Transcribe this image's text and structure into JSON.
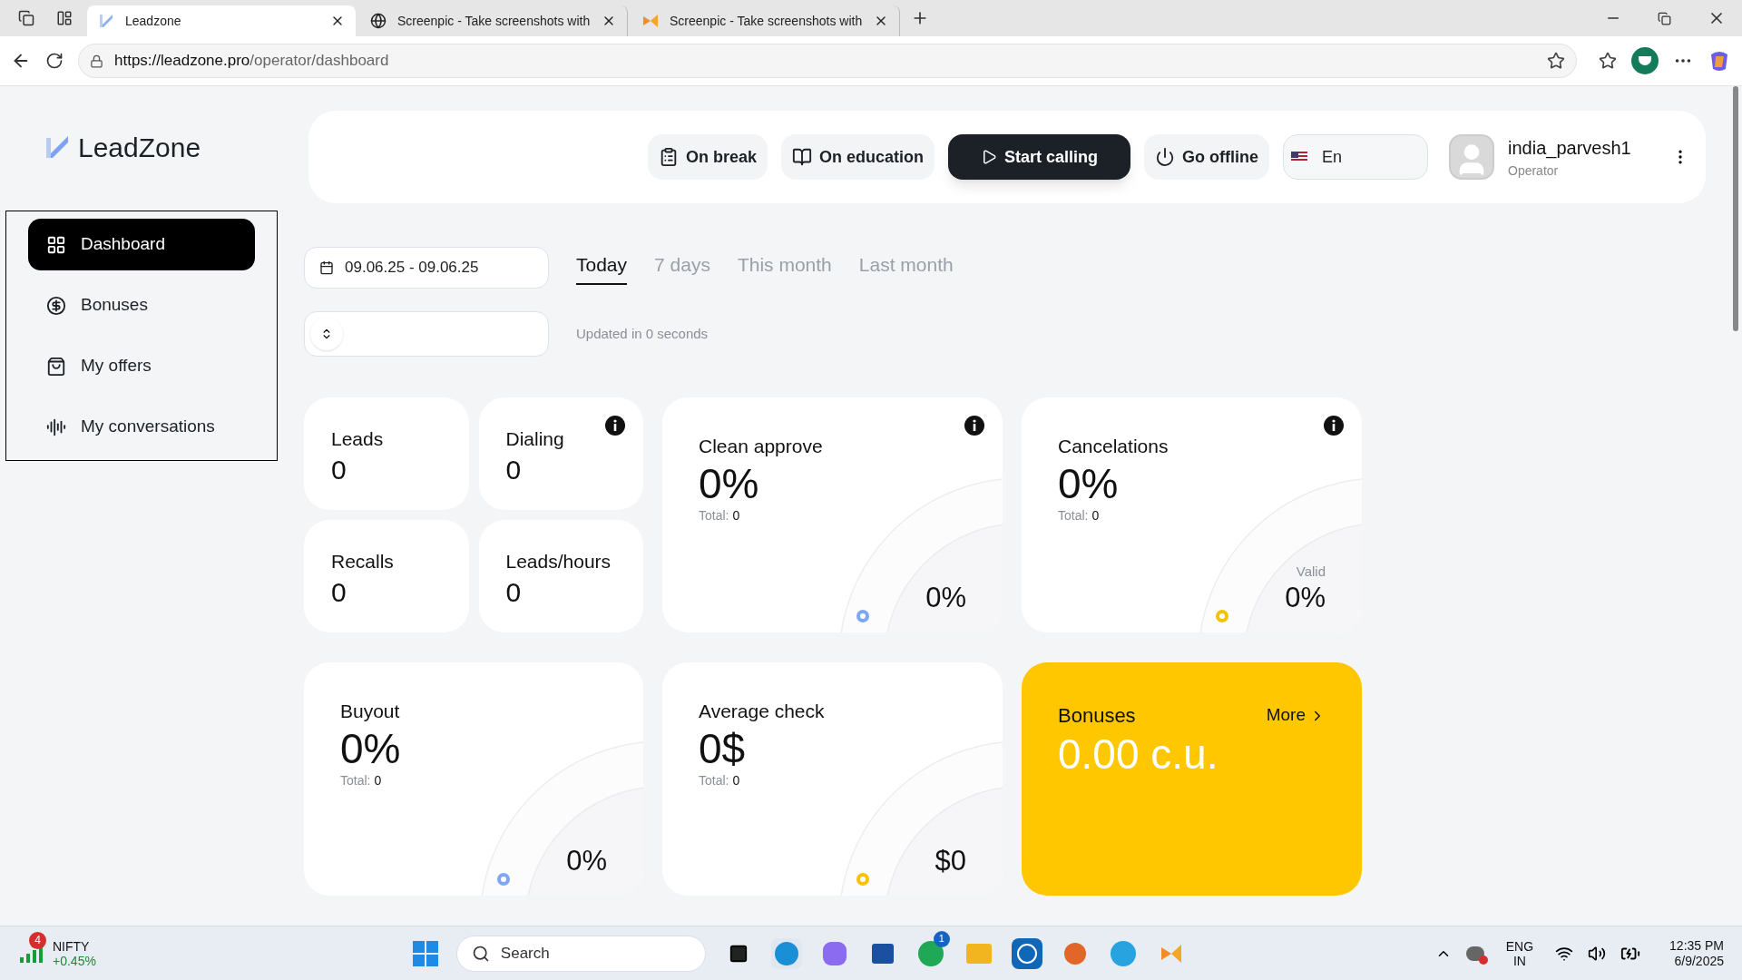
{
  "browser": {
    "tabs": [
      {
        "title": "Leadzone",
        "kind": "leadzone",
        "selected": true
      },
      {
        "title": "Screenpic - Take screenshots with",
        "kind": "globe",
        "selected": false
      },
      {
        "title": "Screenpic - Take screenshots with",
        "kind": "screenpic",
        "selected": false
      }
    ],
    "address": {
      "host": "https://leadzone.pro",
      "path": "/operator/dashboard"
    }
  },
  "sidebar": {
    "logo": "LeadZone",
    "items": [
      {
        "label": "Dashboard",
        "kind": "dashboard",
        "selected": true
      },
      {
        "label": "Bonuses",
        "kind": "bonuses",
        "selected": false
      },
      {
        "label": "My offers",
        "kind": "offers",
        "selected": false
      },
      {
        "label": "My conversations",
        "kind": "conversations",
        "selected": false
      }
    ]
  },
  "header": {
    "buttons": [
      {
        "label": "On break",
        "kind": "break"
      },
      {
        "label": "On education",
        "kind": "education"
      },
      {
        "label": "Start calling",
        "kind": "call"
      },
      {
        "label": "Go offline",
        "kind": "offline"
      }
    ],
    "language": "En",
    "user": {
      "name": "india_parvesh1",
      "role": "Operator"
    }
  },
  "filters": {
    "date_range": "09.06.25 - 09.06.25",
    "periods": [
      {
        "label": "Today",
        "selected": true
      },
      {
        "label": "7 days",
        "selected": false
      },
      {
        "label": "This month",
        "selected": false
      },
      {
        "label": "Last month",
        "selected": false
      }
    ],
    "updated": "Updated in 0 seconds"
  },
  "small_stats": [
    {
      "label": "Leads",
      "value": "0",
      "info": false
    },
    {
      "label": "Dialing",
      "value": "0",
      "info": true
    },
    {
      "label": "Recalls",
      "value": "0",
      "info": false
    },
    {
      "label": "Leads/hours",
      "value": "0",
      "info": false
    }
  ],
  "gauges": [
    {
      "title": "Clean approve",
      "value": "0%",
      "total_label": "Total:",
      "total": "0",
      "gauge_value": "0%",
      "color": "#7fa6f5",
      "info": true
    },
    {
      "title": "Cancelations",
      "value": "0%",
      "total_label": "Total:",
      "total": "0",
      "gauge_label": "Valid",
      "gauge_value": "0%",
      "color": "#f5c200",
      "info": true
    },
    {
      "title": "Buyout",
      "value": "0%",
      "total_label": "Total:",
      "total": "0",
      "gauge_value": "0%",
      "color": "#7fa6f5",
      "info": false
    },
    {
      "title": "Average check",
      "value": "0$",
      "total_label": "Total:",
      "total": "0",
      "gauge_value": "$0",
      "color": "#f5c200",
      "info": false
    }
  ],
  "bonuses": {
    "title": "Bonuses",
    "more": "More",
    "value": "0.00 c.u."
  },
  "taskbar": {
    "stock": {
      "badge": "4",
      "name": "NIFTY",
      "change": "+0.45%"
    },
    "search": "Search",
    "whatsapp_badge": "1",
    "language": [
      "ENG",
      "IN"
    ],
    "time": "12:35 PM",
    "date": "6/9/2025"
  }
}
